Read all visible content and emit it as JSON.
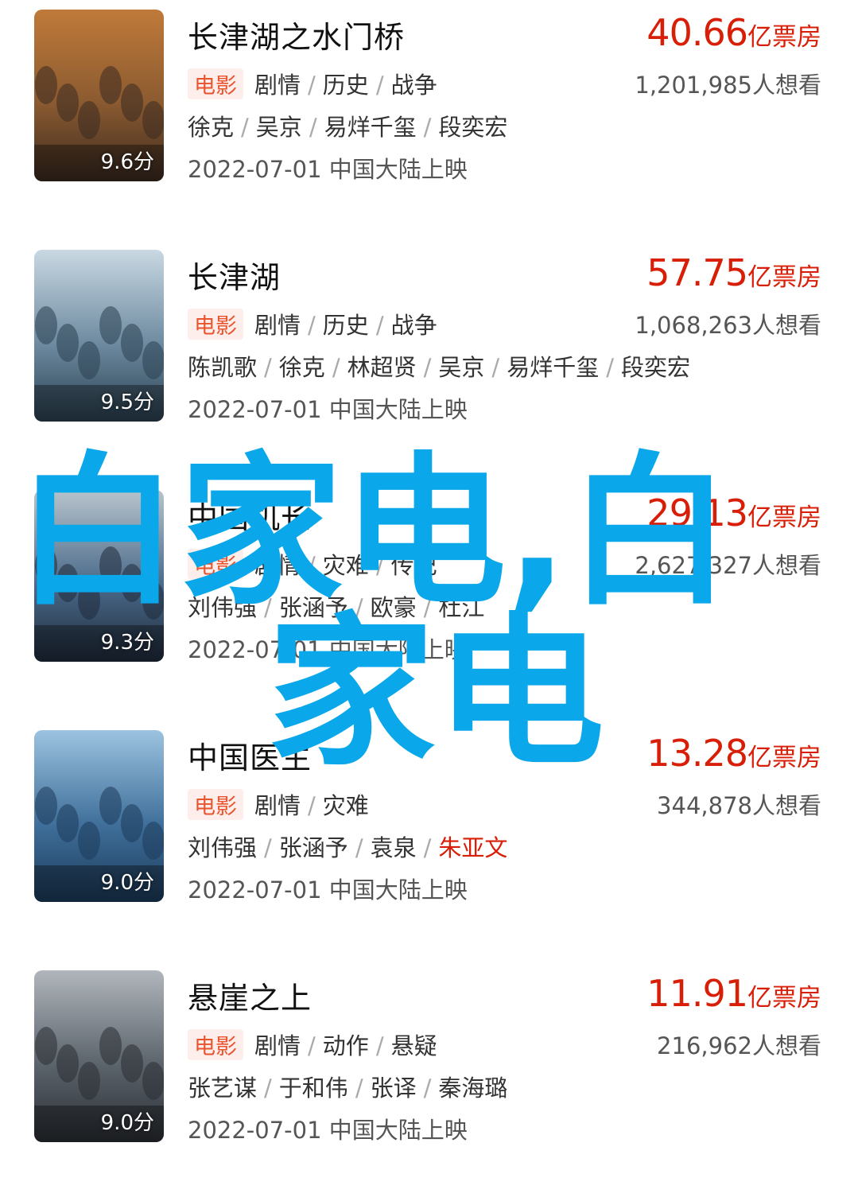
{
  "movies": [
    {
      "title": "长津湖之水门桥",
      "badge": "电影",
      "genres": [
        "剧情",
        "历史",
        "战争"
      ],
      "cast": [
        "徐克",
        "吴京",
        "易烊千玺",
        "段奕宏"
      ],
      "highlighted_cast": "",
      "release": "2022-07-01 中国大陆上映",
      "score": "9.6分",
      "box_office": "40.66",
      "box_unit": "亿票房",
      "want_count": "1,201,985",
      "want_label": "人想看",
      "poster_colors": [
        "#3a2a20",
        "#8a5a30",
        "#c07a3a"
      ]
    },
    {
      "title": "长津湖",
      "badge": "电影",
      "genres": [
        "剧情",
        "历史",
        "战争"
      ],
      "cast": [
        "陈凯歌",
        "徐克",
        "林超贤",
        "吴京",
        "易烊千玺",
        "段奕宏"
      ],
      "highlighted_cast": "",
      "release": "2022-07-01 中国大陆上映",
      "score": "9.5分",
      "box_office": "57.75",
      "box_unit": "亿票房",
      "want_count": "1,068,263",
      "want_label": "人想看",
      "poster_colors": [
        "#2a4050",
        "#6d8aa0",
        "#c9d8e2"
      ]
    },
    {
      "title": "中国机长",
      "badge": "电影",
      "genres": [
        "剧情",
        "灾难",
        "传记"
      ],
      "cast": [
        "刘伟强",
        "张涵予",
        "欧豪",
        "杜江"
      ],
      "highlighted_cast": "",
      "release": "2022-07-01 中国大陆上映",
      "score": "9.3分",
      "box_office": "29.13",
      "box_unit": "亿票房",
      "want_count": "2,627,327",
      "want_label": "人想看",
      "poster_colors": [
        "#1f2a3a",
        "#4a6a8a",
        "#b8c4cc"
      ]
    },
    {
      "title": "中国医生",
      "badge": "电影",
      "genres": [
        "剧情",
        "灾难"
      ],
      "cast": [
        "刘伟强",
        "张涵予",
        "袁泉"
      ],
      "highlighted_cast": "朱亚文",
      "release": "2022-07-01 中国大陆上映",
      "score": "9.0分",
      "box_office": "13.28",
      "box_unit": "亿票房",
      "want_count": "344,878",
      "want_label": "人想看",
      "poster_colors": [
        "#1c3a5a",
        "#3f6f9a",
        "#9cc3e0"
      ]
    },
    {
      "title": "悬崖之上",
      "badge": "电影",
      "genres": [
        "剧情",
        "动作",
        "悬疑"
      ],
      "cast": [
        "张艺谋",
        "于和伟",
        "张译",
        "秦海璐"
      ],
      "highlighted_cast": "",
      "release": "2022-07-01 中国大陆上映",
      "score": "9.0分",
      "box_office": "11.91",
      "box_unit": "亿票房",
      "want_count": "216,962",
      "want_label": "人想看",
      "poster_colors": [
        "#2a2e33",
        "#5b636b",
        "#b0b6bb"
      ]
    }
  ],
  "watermark": {
    "line1": "白家电,白",
    "line2": "家电",
    "color": "#0aa8ea"
  }
}
